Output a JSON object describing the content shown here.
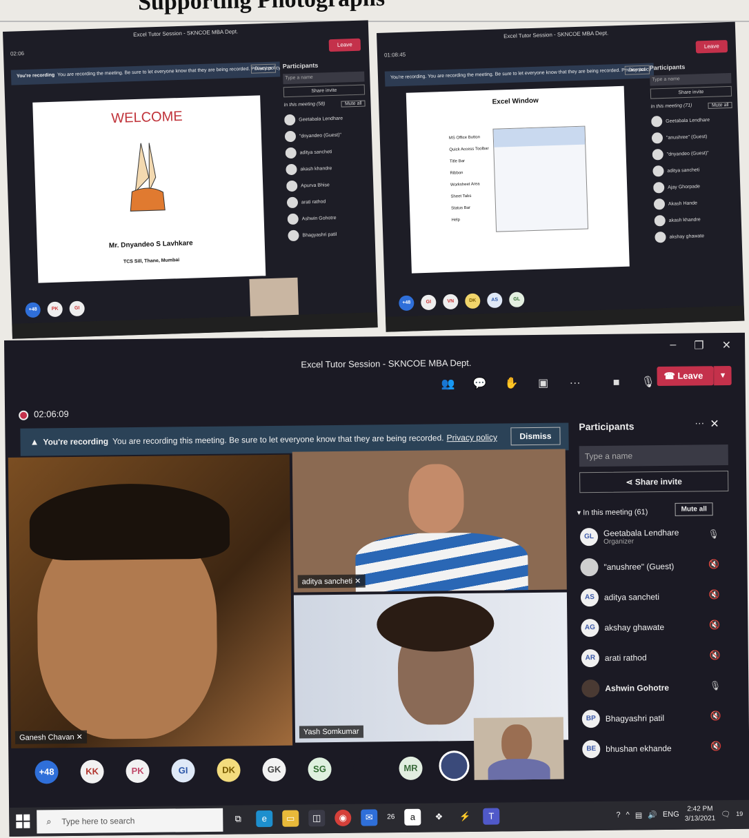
{
  "heading": "Supporting Photographs",
  "shot1": {
    "title": "Excel Tutor Session - SKNCOE MBA Dept.",
    "timer": "02:06",
    "leave": "Leave",
    "banner_bold": "You're recording",
    "banner_text": "You are recording the meeting. Be sure to let everyone know that they are being recorded. Privacy policy",
    "dismiss": "Dismiss",
    "slide_welcome": "WELCOME",
    "slide_name": "Mr. Dnyandeo S Lavhkare",
    "slide_sub": "TCS Sill, Thane, Mumbai",
    "participants_title": "Participants",
    "type_name": "Type a name",
    "share": "Share invite",
    "in_meeting": "In this meeting (58)",
    "mute_all": "Mute all",
    "people": [
      "Geetabala Lendhare",
      "\"dnyandeo (Guest)\"",
      "aditya sancheti",
      "akash khandre",
      "Apurva Bhise",
      "arati rathod",
      "Ashwin Gohotre",
      "Bhagyashri patil"
    ],
    "tray": [
      "+48",
      "PK",
      "GI"
    ]
  },
  "shot2": {
    "title": "Excel Tutor Session - SKNCOE MBA Dept.",
    "timer": "01:08:45",
    "leave": "Leave",
    "banner_text": "You're recording. You are recording the meeting. Be sure to let everyone know that they are being recorded. Privacy policy",
    "dismiss": "Dismiss",
    "excel_title": "Excel Window",
    "excel_labels": [
      "MS Office Button",
      "Quick Access Toolbar",
      "Title Bar",
      "Ribbon",
      "Worksheet Area",
      "Sheet Tabs",
      "Status Bar",
      "Help"
    ],
    "participants_title": "Participants",
    "type_name": "Type a name",
    "share": "Share invite",
    "in_meeting": "In this meeting (71)",
    "mute_all": "Mute all",
    "people": [
      "Geetabala Lendhare",
      "\"anushree\" (Guest)",
      "\"dnyandeo (Guest)\"",
      "aditya sancheti",
      "Ajay Ghorpade",
      "Akash Hande",
      "akash khandre",
      "akshay ghawate"
    ],
    "tray": [
      "+48",
      "GI",
      "VN",
      "DK",
      "AS",
      "GL"
    ]
  },
  "main": {
    "window_title": "Excel Tutor Session - SKNCOE MBA Dept.",
    "timer": "02:06:09",
    "leave": "Leave",
    "banner_bold": "You're recording",
    "banner_text": "You are recording this meeting. Be sure to let everyone know that they are being recorded.",
    "privacy": "Privacy policy",
    "dismiss": "Dismiss",
    "tiles": {
      "left": "Ganesh Chavan",
      "top_right": "aditya sancheti",
      "bottom_right": "Yash Somkumar"
    },
    "participants": {
      "title": "Participants",
      "search_placeholder": "Type a name",
      "share": "Share invite",
      "in_meeting": "In this meeting (61)",
      "mute_all": "Mute all",
      "people": [
        {
          "initials": "GL",
          "name": "Geetabala Lendhare",
          "sub": "Organizer",
          "mic": "on"
        },
        {
          "initials": "",
          "name": "\"anushree\" (Guest)",
          "sub": "",
          "mic": "muted"
        },
        {
          "initials": "AS",
          "name": "aditya sancheti",
          "sub": "",
          "mic": "muted"
        },
        {
          "initials": "AG",
          "name": "akshay ghawate",
          "sub": "",
          "mic": "muted"
        },
        {
          "initials": "AR",
          "name": "arati rathod",
          "sub": "",
          "mic": "muted"
        },
        {
          "initials": "",
          "name": "Ashwin Gohotre",
          "sub": "",
          "mic": "on"
        },
        {
          "initials": "BP",
          "name": "Bhagyashri patil",
          "sub": "",
          "mic": "muted"
        },
        {
          "initials": "BE",
          "name": "bhushan ekhande",
          "sub": "",
          "mic": "muted"
        }
      ]
    },
    "overflow": [
      "+48",
      "KK",
      "PK",
      "GI",
      "DK",
      "GK",
      "SG",
      "",
      "MR",
      ""
    ],
    "taskbar": {
      "search_placeholder": "Type here to search",
      "lang": "ENG",
      "time": "2:42 PM",
      "date": "3/13/2021",
      "badge": "26",
      "notif": "19"
    }
  }
}
